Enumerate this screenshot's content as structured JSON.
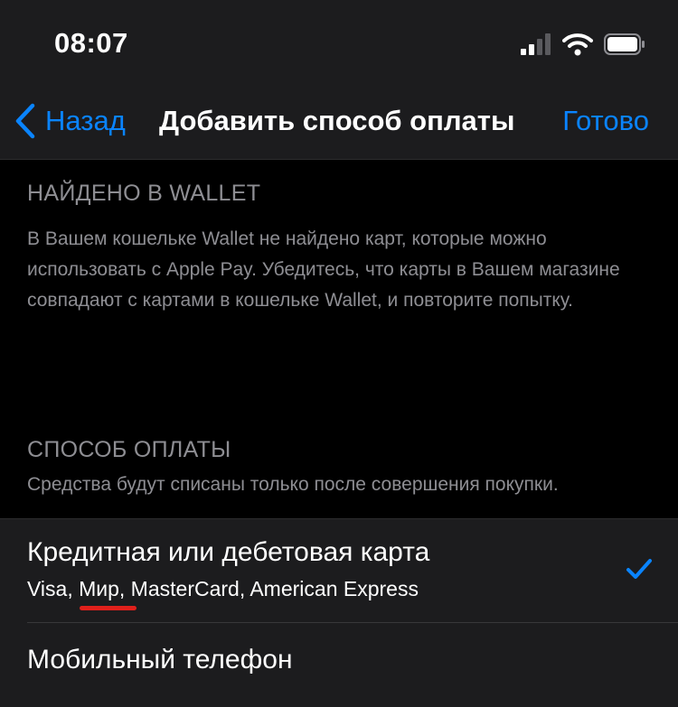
{
  "status_bar": {
    "time": "08:07",
    "icons": [
      "cellular-signal-icon",
      "wifi-icon",
      "battery-icon"
    ]
  },
  "nav": {
    "back_label": "Назад",
    "title": "Добавить способ оплаты",
    "done_label": "Готово"
  },
  "wallet_section": {
    "header": "НАЙДЕНО В WALLET",
    "footer": "В Вашем кошельке Wallet не найдено карт, которые можно использовать с Apple Pay. Убедитесь, что карты в Вашем магазине совпадают с картами в кошельке Wallet, и повторите попытку."
  },
  "payment_section": {
    "header": "СПОСОБ ОПЛАТЫ",
    "footer": "Средства будут списаны только после совершения покупки.",
    "options": [
      {
        "title": "Кредитная или дебетовая карта",
        "subtitle": "Visa, Мир, MasterCard, American Express",
        "selected": true
      },
      {
        "title": "Мобильный телефон",
        "selected": false
      }
    ]
  },
  "colors": {
    "accent": "#0a84ff",
    "background": "#000000",
    "bar_background": "#1c1c1e",
    "secondary_text": "#8e8e93",
    "annotation_underline": "#e0201b"
  }
}
